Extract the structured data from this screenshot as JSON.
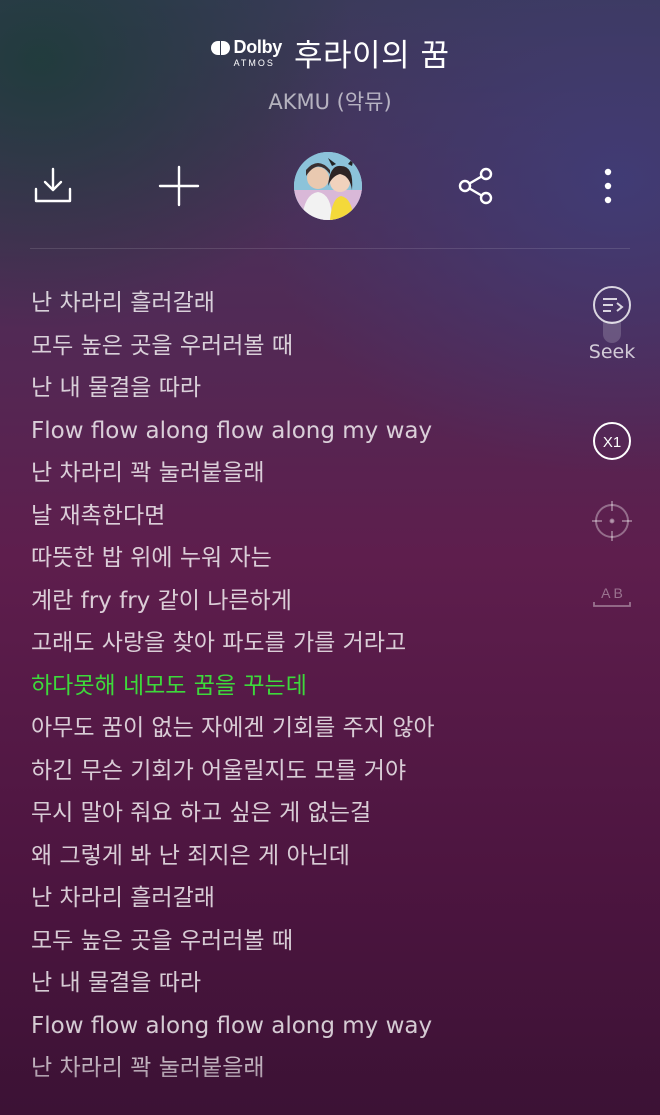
{
  "header": {
    "badge": {
      "brand": "Dolby",
      "sub": "ATMOS"
    },
    "title": "후라이의 꿈",
    "artist": "AKMU (악뮤)"
  },
  "actions": [
    {
      "name": "download",
      "icon": "download-icon"
    },
    {
      "name": "add",
      "icon": "plus-icon"
    },
    {
      "name": "artist-avatar",
      "icon": "avatar"
    },
    {
      "name": "share",
      "icon": "share-icon"
    },
    {
      "name": "more",
      "icon": "more-vertical-icon"
    }
  ],
  "side_tools": {
    "seek_label": "Seek",
    "speed_label": "X1",
    "ab_label": "A B"
  },
  "lyrics": [
    {
      "text": "난 차라리 흘러갈래",
      "active": false
    },
    {
      "text": "모두 높은 곳을 우러러볼 때",
      "active": false
    },
    {
      "text": "난 내 물결을 따라",
      "active": false
    },
    {
      "text": "Flow flow along flow along my way",
      "active": false
    },
    {
      "text": "난 차라리 꽉 눌러붙을래",
      "active": false
    },
    {
      "text": "날 재촉한다면",
      "active": false
    },
    {
      "text": "따뜻한 밥 위에 누워 자는",
      "active": false
    },
    {
      "text": "계란 fry fry 같이 나른하게",
      "active": false
    },
    {
      "text": "고래도 사랑을 찾아 파도를 가를 거라고",
      "active": false
    },
    {
      "text": "하다못해 네모도 꿈을 꾸는데",
      "active": true
    },
    {
      "text": "아무도 꿈이 없는 자에겐 기회를 주지 않아",
      "active": false
    },
    {
      "text": "하긴 무슨 기회가 어울릴지도 모를 거야",
      "active": false
    },
    {
      "text": "무시 말아 줘요 하고 싶은 게 없는걸",
      "active": false
    },
    {
      "text": "왜 그렇게 봐 난 죄지은 게 아닌데",
      "active": false
    },
    {
      "text": "난 차라리 흘러갈래",
      "active": false
    },
    {
      "text": "모두 높은 곳을 우러러볼 때",
      "active": false
    },
    {
      "text": "난 내 물결을 따라",
      "active": false
    },
    {
      "text": "Flow flow along flow along my way",
      "active": false
    },
    {
      "text": "난 차라리 꽉 눌러붙을래",
      "active": false
    }
  ],
  "colors": {
    "active_lyric": "#3dd93b",
    "lyric": "#ffffffc8"
  }
}
